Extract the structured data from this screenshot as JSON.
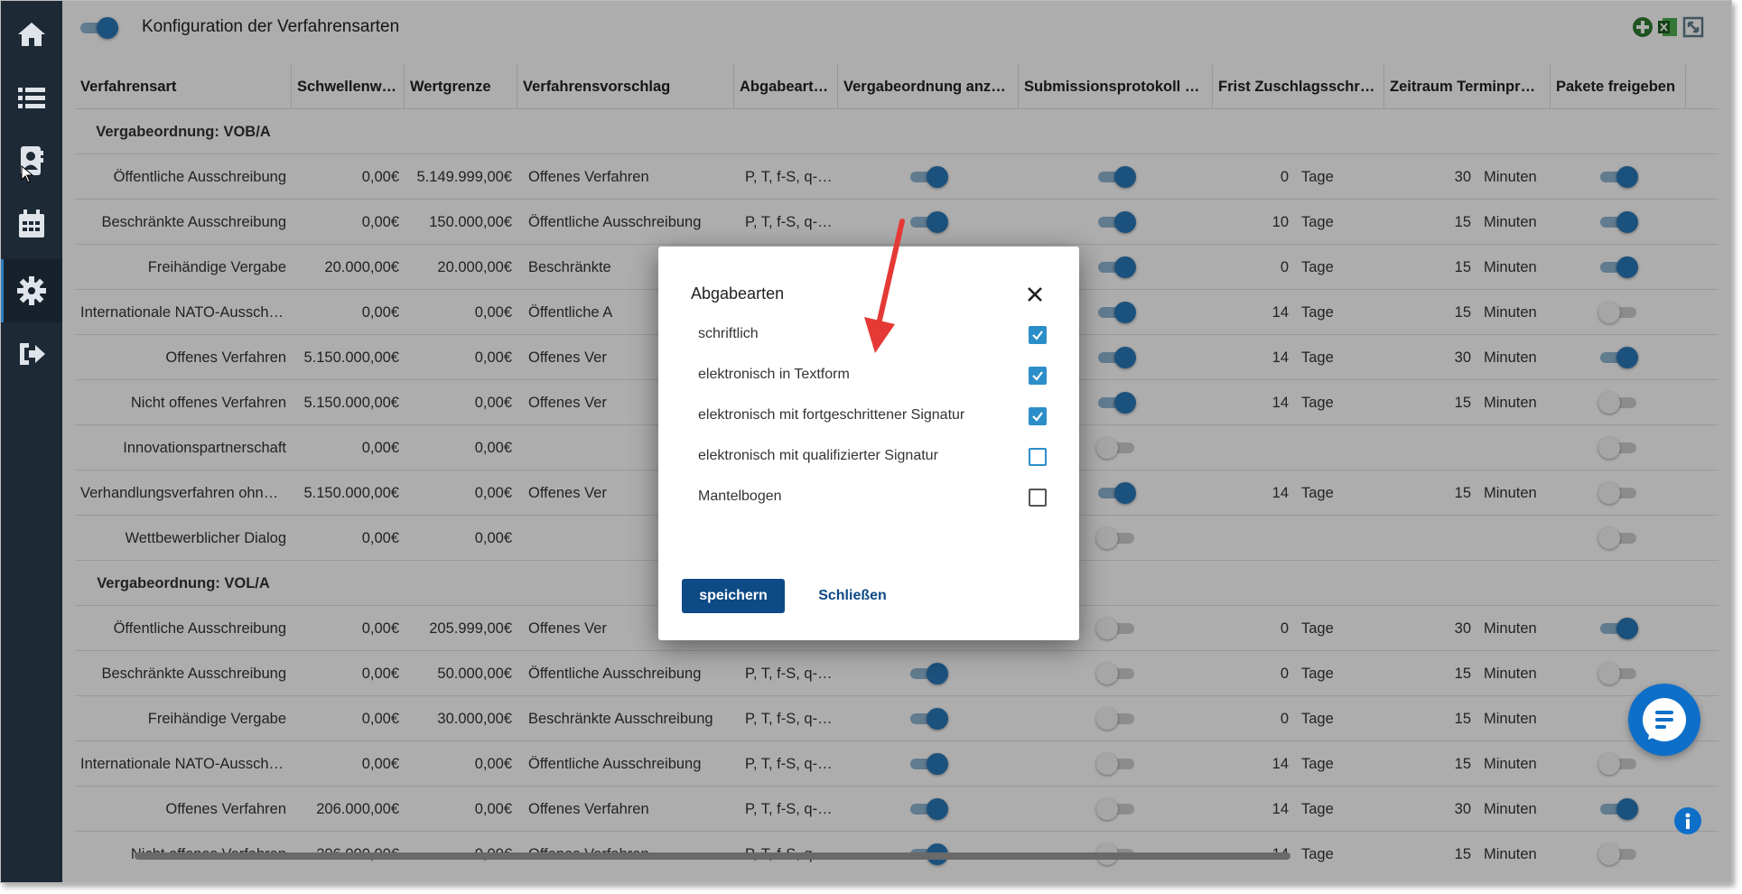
{
  "page": {
    "title": "Konfiguration der Verfahrensarten"
  },
  "sidebar": {
    "items": [
      {
        "name": "home",
        "icon": "home-icon"
      },
      {
        "name": "list",
        "icon": "list-icon"
      },
      {
        "name": "contacts",
        "icon": "contact-book-icon"
      },
      {
        "name": "calendar",
        "icon": "calendar-icon"
      },
      {
        "name": "settings",
        "icon": "gear-icon",
        "active": true
      },
      {
        "name": "logout",
        "icon": "logout-icon"
      }
    ]
  },
  "toolbar": {
    "icons": [
      "add-circle-icon",
      "excel-export-icon",
      "fullscreen-icon"
    ]
  },
  "table": {
    "headers": [
      "Verfahrensart",
      "Schwellenwert",
      "Wertgrenze",
      "Verfahrensvorschlag",
      "Abgabeart(en)",
      "Vergabeordnung anzeigen",
      "Submissionsprotokoll Bieter",
      "Frist Zuschlagsschreiben",
      "Zeitraum Terminprüfung",
      "Pakete freigeben"
    ],
    "rows": [
      {
        "group": "Vergabeordnung: VOB/A"
      },
      {
        "name": "Öffentliche Ausschreibung",
        "sw": "0,00€",
        "wg": "5.149.999,00€",
        "vv": "Offenes Verfahren",
        "ab": "P, T, f-S, q-S, ...",
        "vo": true,
        "sp": true,
        "fz": "0",
        "fzu": "Tage",
        "zt": "30",
        "ztu": "Minuten",
        "pf": true
      },
      {
        "name": "Beschränkte Ausschreibung",
        "sw": "0,00€",
        "wg": "150.000,00€",
        "vv": "Öffentliche Ausschreibung",
        "ab": "P, T, f-S, q-S, ...",
        "vo": true,
        "sp": true,
        "fz": "10",
        "fzu": "Tage",
        "zt": "15",
        "ztu": "Minuten",
        "pf": true
      },
      {
        "name": "Freihändige Vergabe",
        "sw": "20.000,00€",
        "wg": "20.000,00€",
        "vv": "Beschränkte",
        "ab": "",
        "vo": null,
        "sp": true,
        "fz": "0",
        "fzu": "Tage",
        "zt": "15",
        "ztu": "Minuten",
        "pf": true
      },
      {
        "name": "Internationale NATO-Ausschrei...",
        "sw": "0,00€",
        "wg": "0,00€",
        "vv": "Öffentliche A",
        "ab": "",
        "vo": null,
        "sp": true,
        "fz": "14",
        "fzu": "Tage",
        "zt": "15",
        "ztu": "Minuten",
        "pf": false
      },
      {
        "name": "Offenes Verfahren",
        "sw": "5.150.000,00€",
        "wg": "0,00€",
        "vv": "Offenes Ver",
        "ab": "",
        "vo": null,
        "sp": true,
        "fz": "14",
        "fzu": "Tage",
        "zt": "30",
        "ztu": "Minuten",
        "pf": true
      },
      {
        "name": "Nicht offenes Verfahren",
        "sw": "5.150.000,00€",
        "wg": "0,00€",
        "vv": "Offenes Ver",
        "ab": "",
        "vo": null,
        "sp": true,
        "fz": "14",
        "fzu": "Tage",
        "zt": "15",
        "ztu": "Minuten",
        "pf": false
      },
      {
        "name": "Innovationspartnerschaft",
        "sw": "0,00€",
        "wg": "0,00€",
        "vv": "",
        "ab": "",
        "vo": null,
        "sp": false,
        "fz": "",
        "fzu": "",
        "zt": "",
        "ztu": "",
        "pf": false
      },
      {
        "name": "Verhandlungsverfahren ohne T...",
        "sw": "5.150.000,00€",
        "wg": "0,00€",
        "vv": "Offenes Ver",
        "ab": "",
        "vo": null,
        "sp": true,
        "fz": "14",
        "fzu": "Tage",
        "zt": "15",
        "ztu": "Minuten",
        "pf": false
      },
      {
        "name": "Wettbewerblicher Dialog",
        "sw": "0,00€",
        "wg": "0,00€",
        "vv": "",
        "ab": "",
        "vo": null,
        "sp": false,
        "fz": "",
        "fzu": "",
        "zt": "",
        "ztu": "",
        "pf": false
      },
      {
        "group": "Vergabeordnung: VOL/A"
      },
      {
        "name": "Öffentliche Ausschreibung",
        "sw": "0,00€",
        "wg": "205.999,00€",
        "vv": "Offenes Ver",
        "ab": "",
        "vo": null,
        "sp": false,
        "fz": "0",
        "fzu": "Tage",
        "zt": "30",
        "ztu": "Minuten",
        "pf": true
      },
      {
        "name": "Beschränkte Ausschreibung",
        "sw": "0,00€",
        "wg": "50.000,00€",
        "vv": "Öffentliche Ausschreibung",
        "ab": "P, T, f-S, q-S, ...",
        "vo": true,
        "sp": false,
        "fz": "0",
        "fzu": "Tage",
        "zt": "15",
        "ztu": "Minuten",
        "pf": false
      },
      {
        "name": "Freihändige Vergabe",
        "sw": "0,00€",
        "wg": "30.000,00€",
        "vv": "Beschränkte Ausschreibung",
        "ab": "P, T, f-S, q-S, ...",
        "vo": true,
        "sp": false,
        "fz": "0",
        "fzu": "Tage",
        "zt": "15",
        "ztu": "Minuten",
        "pf": null
      },
      {
        "name": "Internationale NATO-Ausschrei...",
        "sw": "0,00€",
        "wg": "0,00€",
        "vv": "Öffentliche Ausschreibung",
        "ab": "P, T, f-S, q-S, ...",
        "vo": true,
        "sp": false,
        "fz": "14",
        "fzu": "Tage",
        "zt": "15",
        "ztu": "Minuten",
        "pf": false
      },
      {
        "name": "Offenes Verfahren",
        "sw": "206.000,00€",
        "wg": "0,00€",
        "vv": "Offenes Verfahren",
        "ab": "P, T, f-S, q-S, ...",
        "vo": true,
        "sp": false,
        "fz": "14",
        "fzu": "Tage",
        "zt": "30",
        "ztu": "Minuten",
        "pf": true
      },
      {
        "name": "Nicht offenes Verfahren",
        "sw": "206.000,00€",
        "wg": "0,00€",
        "vv": "Offenes Verfahren",
        "ab": "P, T, f-S, q-S, ...",
        "vo": true,
        "sp": false,
        "fz": "14",
        "fzu": "Tage",
        "zt": "15",
        "ztu": "Minuten",
        "pf": false
      }
    ]
  },
  "dialog": {
    "title": "Abgabearten",
    "options": [
      {
        "label": "schriftlich",
        "checked": true
      },
      {
        "label": "elektronisch in Textform",
        "checked": true
      },
      {
        "label": "elektronisch mit fortgeschrittener Signatur",
        "checked": true
      },
      {
        "label": "elektronisch mit qualifizierter Signatur",
        "checked": false,
        "highlight": true
      },
      {
        "label": "Mantelbogen",
        "checked": false
      }
    ],
    "save_label": "speichern",
    "close_label": "Schließen"
  },
  "colors": {
    "sidebar": "#1d2935",
    "accent": "#2878b8",
    "primary_button": "#0e4a86",
    "checkbox": "#2c8ec9",
    "chat": "#0e6fc9",
    "annotation_arrow": "#e53935"
  }
}
